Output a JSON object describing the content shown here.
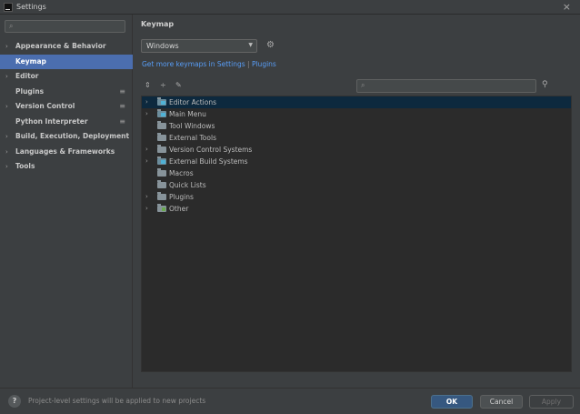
{
  "window": {
    "title": "Settings",
    "close_symbol": "×"
  },
  "sidebar": {
    "search_placeholder": "",
    "items": [
      {
        "label": "Appearance & Behavior",
        "arrow": "›",
        "proj": ""
      },
      {
        "label": "Keymap",
        "arrow": "",
        "proj": "",
        "selected": true
      },
      {
        "label": "Editor",
        "arrow": "›",
        "proj": ""
      },
      {
        "label": "Plugins",
        "arrow": "",
        "proj": "≡"
      },
      {
        "label": "Version Control",
        "arrow": "›",
        "proj": "≡"
      },
      {
        "label": "Python Interpreter",
        "arrow": "",
        "proj": "≡"
      },
      {
        "label": "Build, Execution, Deployment",
        "arrow": "›",
        "proj": ""
      },
      {
        "label": "Languages & Frameworks",
        "arrow": "›",
        "proj": ""
      },
      {
        "label": "Tools",
        "arrow": "›",
        "proj": ""
      }
    ]
  },
  "main": {
    "heading": "Keymap",
    "keymap_value": "Windows",
    "link_more": "Get more keymaps in Settings",
    "link_sep": "|",
    "link_plugins": "Plugins",
    "tree_search_placeholder": "",
    "tree": [
      {
        "label": "Editor Actions",
        "arrow": "›",
        "icon": "special",
        "selected": true
      },
      {
        "label": "Main Menu",
        "arrow": "›",
        "icon": "special"
      },
      {
        "label": "Tool Windows",
        "arrow": "",
        "icon": "folder"
      },
      {
        "label": "External Tools",
        "arrow": "",
        "icon": "folder"
      },
      {
        "label": "Version Control Systems",
        "arrow": "›",
        "icon": "folder"
      },
      {
        "label": "External Build Systems",
        "arrow": "›",
        "icon": "special"
      },
      {
        "label": "Macros",
        "arrow": "",
        "icon": "folder"
      },
      {
        "label": "Quick Lists",
        "arrow": "",
        "icon": "folder"
      },
      {
        "label": "Plugins",
        "arrow": "›",
        "icon": "folder"
      },
      {
        "label": "Other",
        "arrow": "›",
        "icon": "other"
      }
    ]
  },
  "footer": {
    "help": "?",
    "note": "Project-level settings will be applied to new projects",
    "ok": "OK",
    "cancel": "Cancel",
    "apply": "Apply"
  },
  "colors": {
    "accent": "#4b6eaf",
    "link": "#589df6",
    "background": "#3c3f41",
    "tree_bg": "#2b2b2b"
  }
}
